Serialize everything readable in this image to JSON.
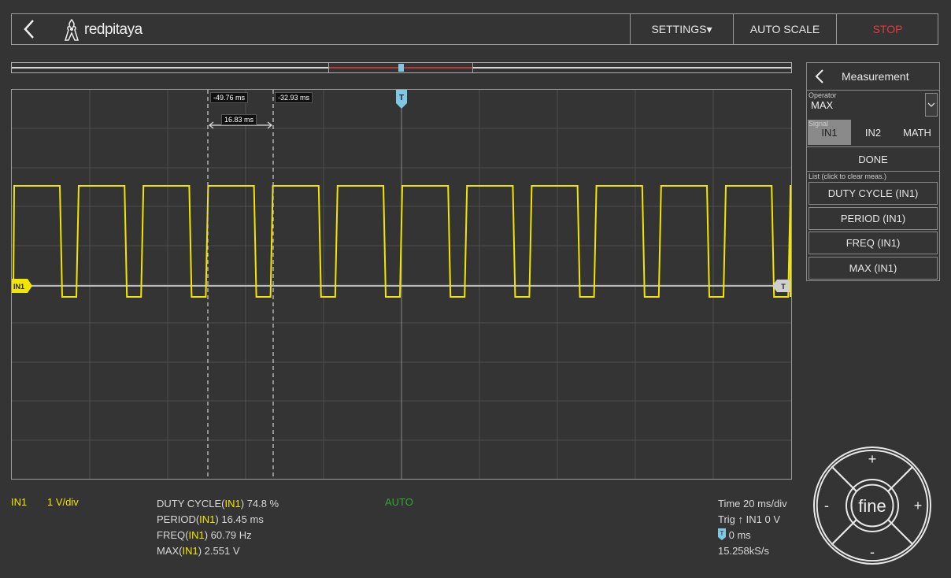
{
  "header": {
    "brand": "redpitaya",
    "settings_label": "SETTINGS▾",
    "autoscale_label": "AUTO SCALE",
    "stop_label": "STOP"
  },
  "cursors": {
    "left_time": "-49.76 ms",
    "right_time": "-32.93 ms",
    "delta": "16.83 ms"
  },
  "plot": {
    "channel_marker": "IN1",
    "trigger_marker": "T",
    "trigger_level_marker": "T"
  },
  "panel": {
    "title": "Measurement",
    "operator_label": "Operator",
    "operator_value": "MAX",
    "signal_label": "Signal",
    "signals": [
      "IN1",
      "IN2",
      "MATH"
    ],
    "done_label": "DONE",
    "list_label": "List (click to clear meas.)",
    "measurements": [
      "DUTY CYCLE (IN1)",
      "PERIOD (IN1)",
      "FREQ (IN1)",
      "MAX (IN1)"
    ]
  },
  "bottom": {
    "channel": "IN1",
    "scale": "1 V/div",
    "status": "AUTO",
    "measures": [
      {
        "name": "DUTY CYCLE(",
        "ch": "IN1",
        "value": ") 74.8 %"
      },
      {
        "name": "PERIOD(",
        "ch": "IN1",
        "value": ") 16.45 ms"
      },
      {
        "name": "FREQ(",
        "ch": "IN1",
        "value": ") 60.79 Hz"
      },
      {
        "name": "MAX(",
        "ch": "IN1",
        "value": ") 2.551 V"
      }
    ],
    "time_div": "Time 20 ms/div",
    "trig_prefix": "Trig",
    "trig_value": "IN1 0 V",
    "trig_offset": "0 ms",
    "sample_rate": "15.258kS/s"
  },
  "wheel": {
    "center_label": "fine",
    "up": "+",
    "down": "-",
    "left": "-",
    "right": "+"
  },
  "colors": {
    "signal": "#f2e600",
    "trigger": "#7ec8e3",
    "stop": "#e63a3a",
    "auto": "#2ea82e"
  }
}
